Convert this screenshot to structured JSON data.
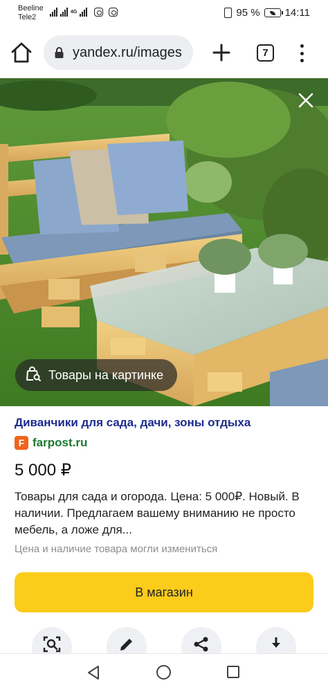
{
  "status_bar": {
    "carrier_1": "Beeline",
    "carrier_2": "Tele2",
    "network": "4G",
    "battery": "95 %",
    "time": "14:11",
    "icons": [
      "signal-icon",
      "instagram-icon",
      "instagram-icon",
      "vibrate-icon",
      "battery-icon"
    ]
  },
  "browser": {
    "url": "yandex.ru/images",
    "tabs_count": "7",
    "icons": [
      "home-icon",
      "lock-icon",
      "plus-icon",
      "tabs-icon",
      "more-vert-icon"
    ]
  },
  "image_viewer": {
    "close_icon": "close-icon",
    "products_chip_label": "Товары на картинке",
    "products_chip_icon": "shopping-bag-search-icon"
  },
  "item": {
    "title": "Диванчики для сада, дачи, зоны отдыха",
    "source_favicon_letter": "F",
    "source": "farpost.ru",
    "price": "5 000 ₽",
    "description": "Товары для сада и огорода. Цена: 5 000₽. Новый. В наличии. Предлагаем вашему вниманию не просто мебель, а ложе для...",
    "disclaimer": "Цена и наличие товара могли измениться",
    "button_label": "В магазин"
  },
  "actions": [
    "lens-search-icon",
    "edit-icon",
    "share-icon",
    "download-icon"
  ],
  "colors": {
    "title_link": "#1d2b8d",
    "source_green": "#197a2e",
    "favicon_orange": "#f2631b",
    "shop_button": "#fccc1b"
  },
  "nav_bar": [
    "back-icon",
    "home-circle-icon",
    "recent-apps-icon"
  ]
}
